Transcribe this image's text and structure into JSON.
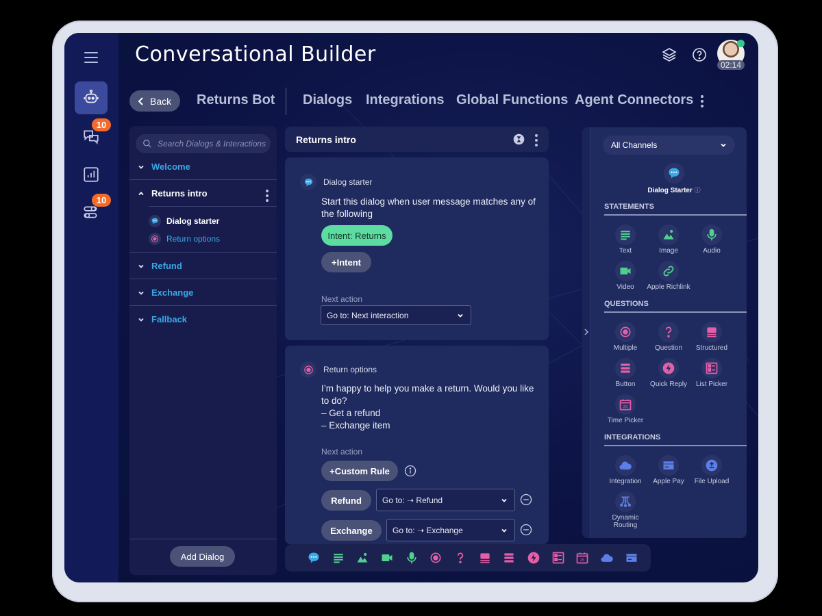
{
  "app": {
    "title": "Conversational Builder",
    "timer": "02:14"
  },
  "colors": {
    "accent_blue": "#3aa9e6",
    "statement_green": "#4fd08f",
    "question_pink": "#e55ea8",
    "integration_blue": "#5b7fe6",
    "badge_orange": "#f26b2a",
    "presence_green": "#35c98a"
  },
  "rail": {
    "items": [
      {
        "name": "bot",
        "icon": "robot-icon",
        "active": true
      },
      {
        "name": "conversations",
        "icon": "chat-bubbles-icon",
        "badge": "10"
      },
      {
        "name": "reports",
        "icon": "bar-chart-icon"
      },
      {
        "name": "settings",
        "icon": "toggles-icon",
        "badge": "10"
      }
    ]
  },
  "nav": {
    "back_label": "Back",
    "bot_name": "Returns Bot",
    "tabs": [
      "Dialogs",
      "Integrations",
      "Global Functions",
      "Agent Connectors"
    ]
  },
  "dialogs": {
    "search_placeholder": "Search Dialogs & Interactions",
    "groups": [
      {
        "label": "Welcome",
        "expanded": false
      },
      {
        "label": "Returns intro",
        "expanded": true,
        "children": [
          "Dialog starter",
          "Return options"
        ]
      },
      {
        "label": "Refund",
        "expanded": false
      },
      {
        "label": "Exchange",
        "expanded": false
      },
      {
        "label": "Fallback",
        "expanded": false
      }
    ],
    "add_label": "Add Dialog"
  },
  "canvas": {
    "title": "Returns intro",
    "starter": {
      "header": "Dialog starter",
      "text": "Start this dialog when user message matches any of the following",
      "intent": "Intent: Returns",
      "add_intent": "+Intent",
      "next_action_label": "Next action",
      "next_action_value": "Go to: Next interaction"
    },
    "options": {
      "header": "Return options",
      "text": "I’m happy to help you make a return. Would you like to do?\n– Get a refund\n– Exchange item",
      "next_action_label": "Next action",
      "custom_rule": "+Custom Rule",
      "rules": [
        {
          "label": "Refund",
          "goto": "Go to: ➝ Refund"
        },
        {
          "label": "Exchange",
          "goto": "Go to: ➝ Exchange"
        }
      ]
    }
  },
  "palette": {
    "channel": "All Channels",
    "starter_label": "Dialog Starter",
    "sections": {
      "statements": "STATEMENTS",
      "questions": "QUESTIONS",
      "integrations": "INTEGRATIONS"
    },
    "statements": [
      "Text",
      "Image",
      "Audio",
      "Video",
      "Apple Richlink"
    ],
    "questions": [
      "Multiple",
      "Question",
      "Structured",
      "Button",
      "Quick Reply",
      "List Picker",
      "Time Picker"
    ],
    "integrations": [
      "Integration",
      "Apple Pay",
      "File Upload",
      "Dynamic Routing"
    ]
  },
  "toolbar": {
    "items": [
      "dialog-starter",
      "text",
      "image",
      "video",
      "audio",
      "multiple",
      "question",
      "structured",
      "button",
      "quick-reply",
      "list-picker",
      "time-picker",
      "integration",
      "apple-pay"
    ]
  }
}
